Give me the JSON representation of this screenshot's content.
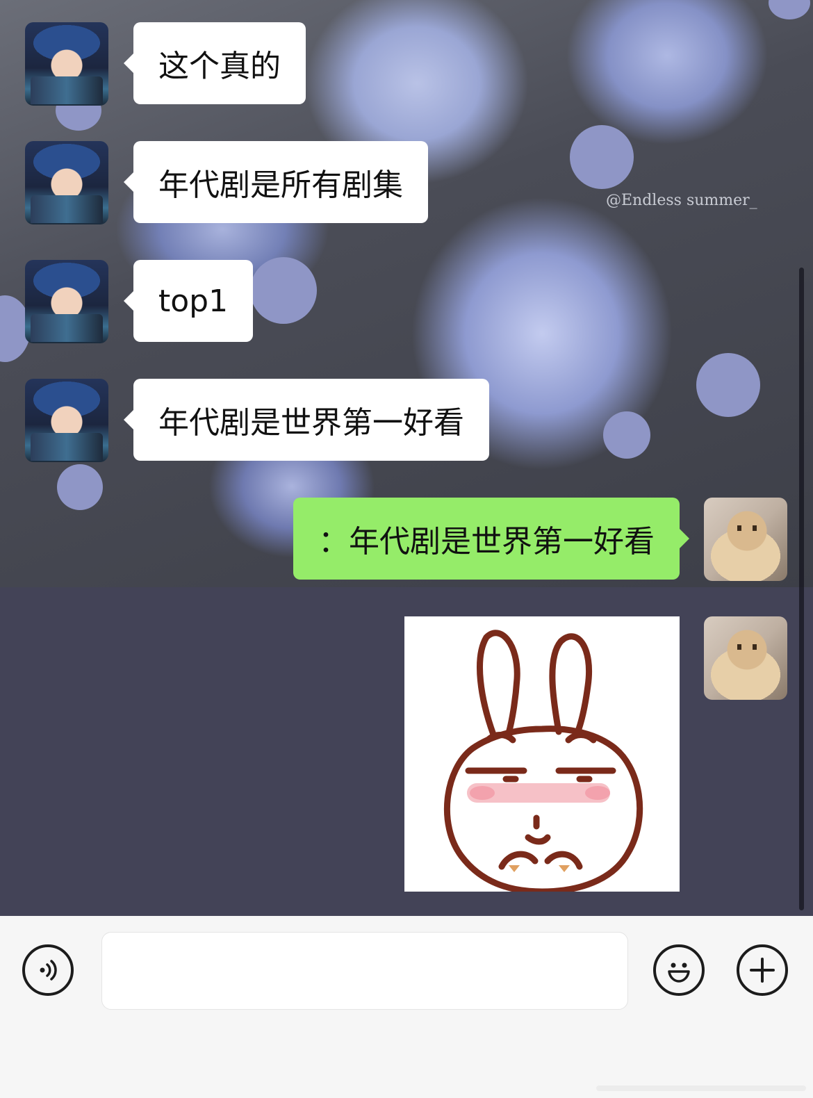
{
  "watermark": "@Endless summer_",
  "messages": [
    {
      "sender": "friend",
      "text": "这个真的"
    },
    {
      "sender": "friend",
      "text": "年代剧是所有剧集"
    },
    {
      "sender": "friend",
      "text": "top1"
    },
    {
      "sender": "friend",
      "text": "年代剧是世界第一好看"
    },
    {
      "sender": "me",
      "text": "：年代剧是世界第一好看"
    },
    {
      "sender": "me",
      "type": "sticker",
      "sticker": "rabbit-smug-sticker"
    }
  ],
  "input": {
    "value": "",
    "placeholder": ""
  },
  "icons": {
    "voice": "voice-icon",
    "emoji": "emoji-icon",
    "more": "plus-icon"
  },
  "colors": {
    "incoming_bubble": "#ffffff",
    "outgoing_bubble": "#95ec69",
    "chat_background": "#434357"
  }
}
